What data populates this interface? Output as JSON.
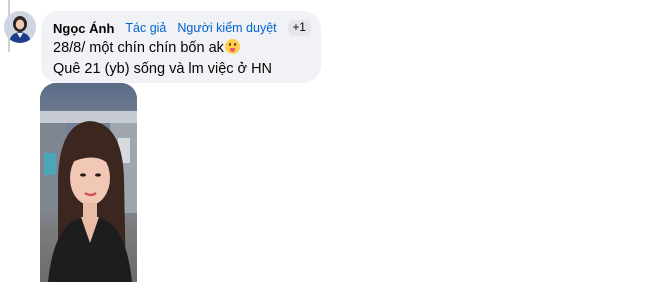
{
  "comment": {
    "author": "Ngọc Ánh",
    "badges": [
      "Tác giả",
      "Người kiểm duyệt"
    ],
    "extra_badge": "+1",
    "lines": [
      "28/8/ một chín chín bốn ak",
      "Quê 21 (yb) sống và lm việc ở HN"
    ],
    "emoji": "grinning-face-with-tongue-emoji"
  },
  "colors": {
    "bubble_bg": "#f0f2f5",
    "badge_link": "#0064d1",
    "text": "#050505"
  }
}
